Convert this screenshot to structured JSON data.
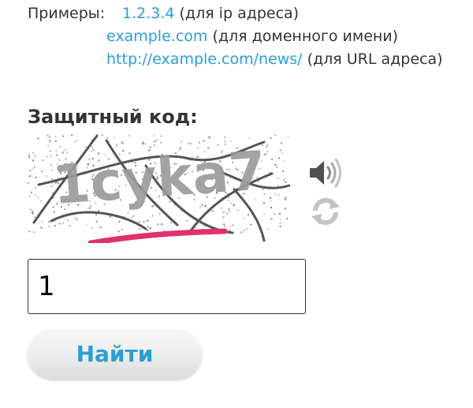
{
  "examples": {
    "label": "Примеры:",
    "items": [
      {
        "link": "1.2.3.4",
        "note": " (для ip адреса)"
      },
      {
        "link": "example.com",
        "note": " (для доменного имени)"
      },
      {
        "link": "http://example.com/news/",
        "note": " (для URL адреса)"
      }
    ]
  },
  "captcha": {
    "heading": "Защитный код:",
    "image_text": "1cyka7",
    "audio_icon": "speaker-icon",
    "refresh_icon": "refresh-icon"
  },
  "form": {
    "code_value": "1",
    "submit_label": "Найти"
  },
  "colors": {
    "link": "#2a9fd6",
    "text": "#333333",
    "underline_mark": "#e0306e"
  }
}
